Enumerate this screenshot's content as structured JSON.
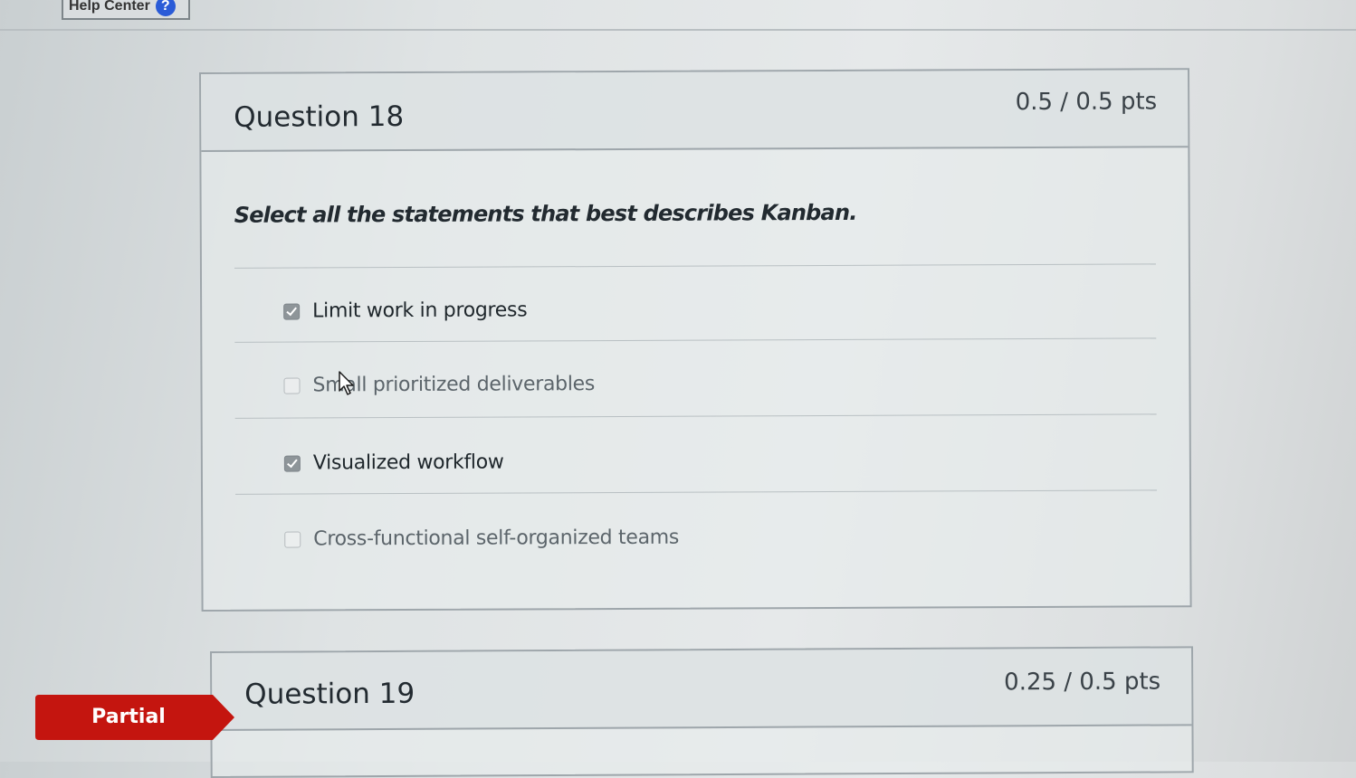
{
  "header": {
    "help_center_label": "Help Center",
    "help_icon_glyph": "?"
  },
  "questions": [
    {
      "title": "Question 18",
      "points": "0.5 / 0.5 pts",
      "prompt": "Select all the statements that best describes Kanban.",
      "answers": [
        {
          "label": "Limit work in progress",
          "checked": true
        },
        {
          "label": "Small prioritized deliverables",
          "checked": false
        },
        {
          "label": "Visualized workflow",
          "checked": true
        },
        {
          "label": "Cross-functional self-organized teams",
          "checked": false
        }
      ]
    },
    {
      "title": "Question 19",
      "points": "0.25 / 0.5 pts",
      "status_badge": "Partial"
    }
  ],
  "colors": {
    "partial_badge": "#c4150f",
    "checkbox_checked": "#8e9599",
    "help_icon": "#2a5bd7"
  }
}
